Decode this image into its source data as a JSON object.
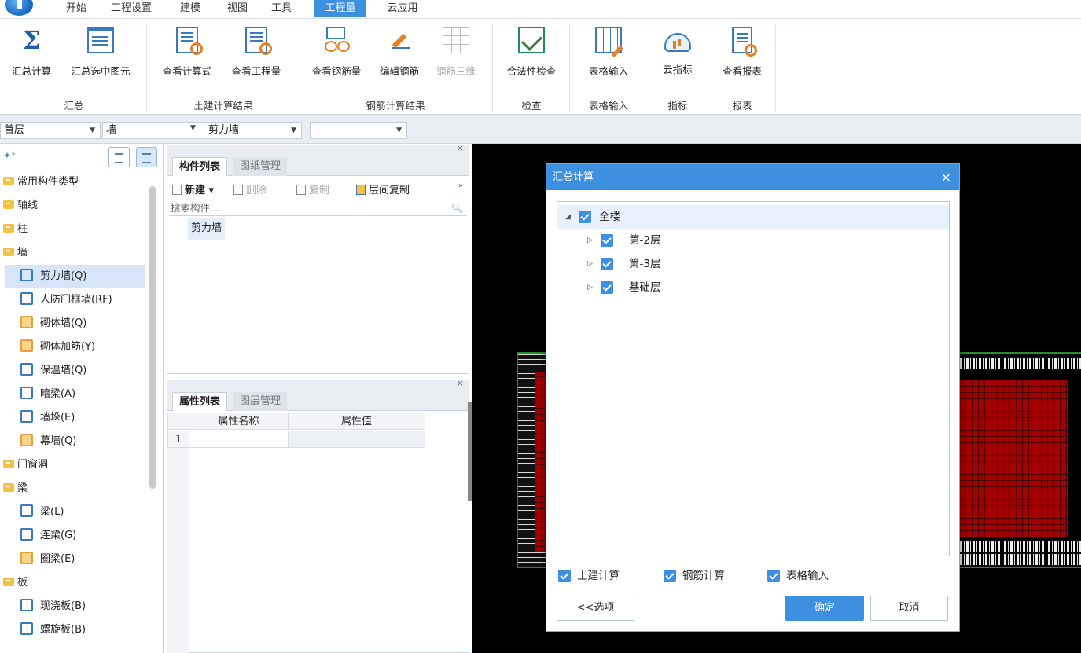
{
  "menu": {
    "items": [
      "开始",
      "工程设置",
      "建模",
      "视图",
      "工具",
      "工程量",
      "云应用"
    ],
    "active_index": 5
  },
  "ribbon": {
    "buttons": {
      "sum_calc": "汇总计算",
      "sum_selected": "汇总选中图元",
      "view_formula": "查看计算式",
      "view_quantity": "查看工程量",
      "view_rebar": "查看钢筋量",
      "edit_rebar": "编辑钢筋",
      "rebar_3d": "钢筋三维",
      "legality_check": "合法性检查",
      "table_input": "表格输入",
      "cloud_index": "云指标",
      "view_report": "查看报表"
    },
    "groups": {
      "summary": "汇总",
      "civil_results": "土建计算结果",
      "rebar_results": "钢筋计算结果",
      "check": "检查",
      "table_input": "表格输入",
      "index": "指标",
      "report": "报表"
    }
  },
  "selectors": {
    "floor": "首层",
    "category": "墙",
    "type": "剪力墙",
    "component": ""
  },
  "nav": {
    "items": [
      {
        "label": "常用构件类型",
        "kind": "folder"
      },
      {
        "label": "轴线",
        "kind": "folder"
      },
      {
        "label": "柱",
        "kind": "folder"
      },
      {
        "label": "墙",
        "kind": "folder-open"
      },
      {
        "label": "剪力墙(Q)",
        "kind": "leaf",
        "selected": true
      },
      {
        "label": "人防门框墙(RF)",
        "kind": "leaf"
      },
      {
        "label": "砌体墙(Q)",
        "kind": "leaf"
      },
      {
        "label": "砌体加筋(Y)",
        "kind": "leaf"
      },
      {
        "label": "保温墙(Q)",
        "kind": "leaf"
      },
      {
        "label": "暗梁(A)",
        "kind": "leaf"
      },
      {
        "label": "墙垛(E)",
        "kind": "leaf"
      },
      {
        "label": "幕墙(Q)",
        "kind": "leaf"
      },
      {
        "label": "门窗洞",
        "kind": "folder"
      },
      {
        "label": "梁",
        "kind": "folder-open"
      },
      {
        "label": "梁(L)",
        "kind": "leaf"
      },
      {
        "label": "连梁(G)",
        "kind": "leaf"
      },
      {
        "label": "圈梁(E)",
        "kind": "leaf"
      },
      {
        "label": "板",
        "kind": "folder-open"
      },
      {
        "label": "现浇板(B)",
        "kind": "leaf"
      },
      {
        "label": "螺旋板(B)",
        "kind": "leaf"
      }
    ]
  },
  "component_panel": {
    "tabs": [
      "构件列表",
      "图纸管理"
    ],
    "tools": {
      "new": "新建",
      "delete": "删除",
      "copy": "复制",
      "floor_copy": "层间复制"
    },
    "search_placeholder": "搜索构件...",
    "items": [
      "剪力墙"
    ]
  },
  "property_panel": {
    "tabs": [
      "属性列表",
      "图层管理"
    ],
    "columns": [
      "属性名称",
      "属性值"
    ],
    "row_numbers": [
      "1"
    ]
  },
  "dialog": {
    "title": "汇总计算",
    "close": "×",
    "tree": [
      {
        "label": "全楼",
        "checked": true,
        "level": 0,
        "expander": "◢"
      },
      {
        "label": "第-2层",
        "checked": true,
        "level": 1,
        "expander": "▷"
      },
      {
        "label": "第-3层",
        "checked": true,
        "level": 1,
        "expander": "▷"
      },
      {
        "label": "基础层",
        "checked": true,
        "level": 1,
        "expander": "▷"
      }
    ],
    "options": [
      "土建计算",
      "钢筋计算",
      "表格输入"
    ],
    "buttons": {
      "options": "<<选项",
      "ok": "确定",
      "cancel": "取消"
    }
  },
  "colors": {
    "accent": "#3d8fe0",
    "canvas": "#000000",
    "grid_red": "#cc1111",
    "outline_green": "#1f8f2b"
  }
}
